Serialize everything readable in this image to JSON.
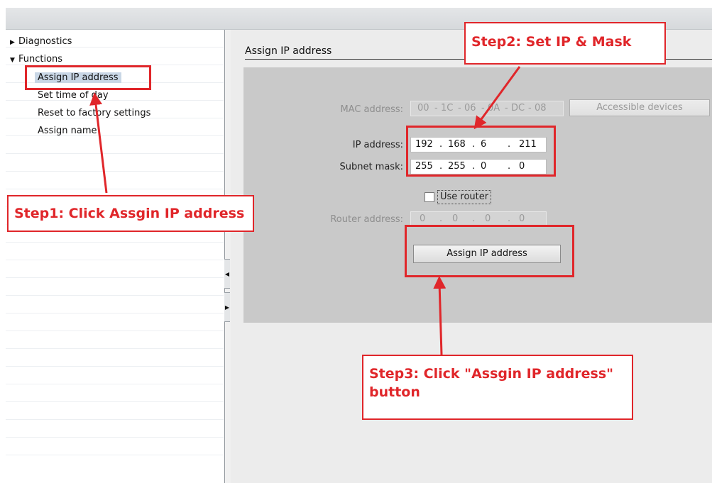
{
  "tree": {
    "items": [
      {
        "label": "Diagnostics",
        "expander": "collapsed-triangle-icon"
      },
      {
        "label": "Functions",
        "expander": "expanded-triangle-icon"
      },
      {
        "label": "Assign IP address",
        "selected": true
      },
      {
        "label": "Set time of day"
      },
      {
        "label": "Reset to factory settings"
      },
      {
        "label": "Assign name"
      }
    ]
  },
  "panel": {
    "title": "Assign IP address",
    "mac_label": "MAC address:",
    "mac_parts": [
      "00",
      "1C",
      "06",
      "0A",
      "DC",
      "08"
    ],
    "accessible_devices_button": "Accessible devices",
    "ip_label": "IP address:",
    "ip_parts": [
      "192",
      "168",
      "6",
      "211"
    ],
    "mask_label": "Subnet mask:",
    "mask_parts": [
      "255",
      "255",
      "0",
      "0"
    ],
    "use_router_label": "Use router",
    "use_router_checked": false,
    "router_label": "Router address:",
    "router_parts": [
      "0",
      "0",
      "0",
      "0"
    ],
    "assign_button": "Assign IP address",
    "separator_dot": ".",
    "separator_dash": "-"
  },
  "annotations": {
    "step1": "Step1: Click Assgin IP address",
    "step2": "Step2: Set IP & Mask",
    "step3_line1": "Step3: Click \"Assgin IP address\"",
    "step3_line2": "button",
    "color": "#e0262a"
  }
}
